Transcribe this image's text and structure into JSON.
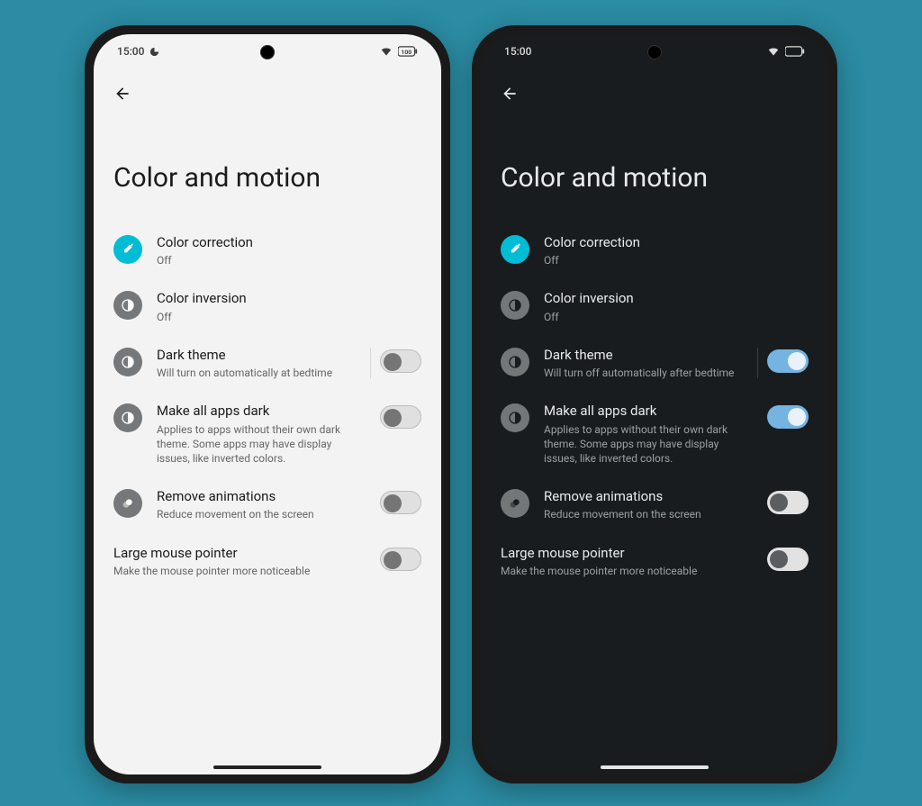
{
  "phones": [
    {
      "theme": "light",
      "status": {
        "time": "15:00",
        "battery": "100"
      },
      "heading": "Color and motion",
      "rows": [
        {
          "icon": "teal",
          "glyph": "eyedropper",
          "title": "Color correction",
          "sub": "Off",
          "toggle": null
        },
        {
          "icon": "grey",
          "glyph": "halfcircle",
          "title": "Color inversion",
          "sub": "Off",
          "toggle": null
        },
        {
          "icon": "grey",
          "glyph": "halfcircle",
          "title": "Dark theme",
          "sub": "Will turn on automatically at bedtime",
          "toggle": "off",
          "divider": true
        },
        {
          "icon": "grey",
          "glyph": "halfcircle",
          "title": "Make all apps dark",
          "sub": "Applies to apps without their own dark theme. Some apps may have display issues, like inverted colors.",
          "toggle": "off"
        },
        {
          "icon": "grey",
          "glyph": "link",
          "title": "Remove animations",
          "sub": "Reduce movement on the screen",
          "toggle": "off"
        },
        {
          "icon": "none",
          "glyph": "",
          "title": "Large mouse pointer",
          "sub": "Make the mouse pointer more noticeable",
          "toggle": "off"
        }
      ]
    },
    {
      "theme": "dark",
      "status": {
        "time": "15:00",
        "battery": ""
      },
      "heading": "Color and motion",
      "rows": [
        {
          "icon": "teal",
          "glyph": "eyedropper",
          "title": "Color correction",
          "sub": "Off",
          "toggle": null
        },
        {
          "icon": "grey",
          "glyph": "halfcircle",
          "title": "Color inversion",
          "sub": "Off",
          "toggle": null
        },
        {
          "icon": "grey",
          "glyph": "halfcircle",
          "title": "Dark theme",
          "sub": "Will turn off automatically after bedtime",
          "toggle": "on",
          "divider": true
        },
        {
          "icon": "grey",
          "glyph": "halfcircle",
          "title": "Make all apps dark",
          "sub": "Applies to apps without their own dark theme. Some apps may have display issues, like inverted colors.",
          "toggle": "on"
        },
        {
          "icon": "grey",
          "glyph": "link",
          "title": "Remove animations",
          "sub": "Reduce movement on the screen",
          "toggle": "off"
        },
        {
          "icon": "none",
          "glyph": "",
          "title": "Large mouse pointer",
          "sub": "Make the mouse pointer more noticeable",
          "toggle": "off"
        }
      ]
    }
  ]
}
